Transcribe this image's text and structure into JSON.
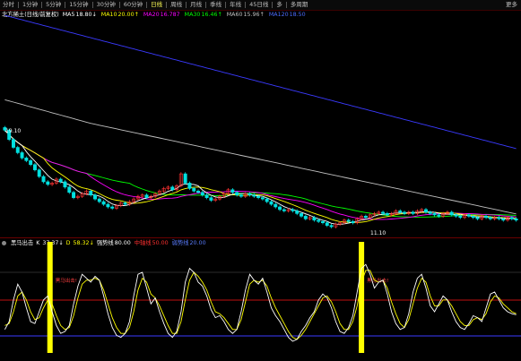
{
  "toolbar": {
    "items": [
      "分时",
      "1分钟",
      "5分钟",
      "15分钟",
      "30分钟",
      "60分钟",
      "日线",
      "周线",
      "月线",
      "季线",
      "年线",
      "45日线",
      "多",
      "多周期"
    ],
    "active_index": 6,
    "right_label": "更多"
  },
  "main_legend": {
    "title": "北方稀土(日线/前复权)",
    "ma": [
      {
        "label": "MA5",
        "value": "18.80↓",
        "color": "#ffffff"
      },
      {
        "label": "MA10",
        "value": "20.00↑",
        "color": "#ffff00"
      },
      {
        "label": "MA20",
        "value": "16.787",
        "color": "#ff00ff"
      },
      {
        "label": "MA30",
        "value": "16.46↑",
        "color": "#00ff00"
      },
      {
        "label": "MA60",
        "value": "15.96↑",
        "color": "#c0c0c0"
      },
      {
        "label": "MA120",
        "value": "18.50",
        "color": "#4a6cff"
      }
    ]
  },
  "price_labels": {
    "high": "19.10",
    "low": "11.10"
  },
  "indicator_legend": {
    "name": "黑马出击",
    "k_label": "K",
    "k_value": "37.37↓",
    "d_label": "D",
    "d_value": "58.32↓",
    "items": [
      {
        "label": "强势线",
        "value": "80.00",
        "color": "#ffffff"
      },
      {
        "label": "中轴线",
        "value": "50.00",
        "color": "#ff3030"
      },
      {
        "label": "弱势线",
        "value": "20.00",
        "color": "#5a7dff"
      }
    ]
  },
  "signal_annotations": [
    "黑马出击!"
  ],
  "colors": {
    "up": "#ff3232",
    "down": "#00e0e0",
    "ma5": "#ffffff",
    "ma10": "#ffff00",
    "ma20": "#ff00ff",
    "ma30": "#00ff00",
    "ma60": "#c0c0c0",
    "ma120": "#3a3aff",
    "signal_bar": "#ffff00"
  },
  "chart_data": {
    "type": "line",
    "candles_count": 120,
    "price_series": [
      18.9,
      18.2,
      17.6,
      17.2,
      16.8,
      16.6,
      16.3,
      15.9,
      15.4,
      15.0,
      14.8,
      14.9,
      15.2,
      15.0,
      14.6,
      14.2,
      13.8,
      13.9,
      14.1,
      14.3,
      14.0,
      13.7,
      13.5,
      13.3,
      13.1,
      13.0,
      13.2,
      13.4,
      13.3,
      13.5,
      13.7,
      13.9,
      14.0,
      13.8,
      13.9,
      14.1,
      14.3,
      14.5,
      14.6,
      14.4,
      14.7,
      15.6,
      14.9,
      14.5,
      14.3,
      14.2,
      14.0,
      13.8,
      13.6,
      13.7,
      13.9,
      14.1,
      14.4,
      14.2,
      14.0,
      13.9,
      14.1,
      14.0,
      13.9,
      13.8,
      13.7,
      13.5,
      13.3,
      13.1,
      12.9,
      12.8,
      12.9,
      12.8,
      12.6,
      12.4,
      12.2,
      12.3,
      12.1,
      12.0,
      11.9,
      11.7,
      11.6,
      11.8,
      11.9,
      12.1,
      12.0,
      11.9,
      12.2,
      12.4,
      12.3,
      12.5,
      12.6,
      12.7,
      12.6,
      12.5,
      12.6,
      12.8,
      12.7,
      12.6,
      12.7,
      12.6,
      12.8,
      12.9,
      12.7,
      12.6,
      12.5,
      12.4,
      12.6,
      12.7,
      12.5,
      12.4,
      12.3,
      12.5,
      12.4,
      12.3,
      12.2,
      12.4,
      12.3,
      12.2,
      12.3,
      12.2,
      12.1,
      12.3,
      12.2,
      12.1
    ],
    "k": [
      22,
      30,
      52,
      68,
      60,
      44,
      30,
      28,
      40,
      52,
      56,
      40,
      26,
      18,
      20,
      26,
      48,
      66,
      78,
      74,
      70,
      76,
      72,
      56,
      38,
      24,
      16,
      14,
      18,
      30,
      56,
      78,
      80,
      64,
      48,
      54,
      40,
      28,
      18,
      14,
      20,
      40,
      70,
      84,
      80,
      70,
      66,
      56,
      42,
      34,
      36,
      30,
      22,
      18,
      22,
      40,
      62,
      78,
      72,
      68,
      74,
      60,
      44,
      36,
      30,
      22,
      14,
      10,
      12,
      20,
      26,
      34,
      40,
      52,
      58,
      54,
      44,
      30,
      20,
      18,
      24,
      36,
      60,
      84,
      88,
      78,
      64,
      70,
      72,
      58,
      40,
      28,
      22,
      24,
      38,
      60,
      74,
      78,
      64,
      46,
      40,
      48,
      56,
      52,
      40,
      30,
      24,
      22,
      28,
      36,
      34,
      30,
      44,
      58,
      60,
      52,
      44,
      40,
      38,
      37
    ],
    "d": [
      26,
      28,
      40,
      56,
      60,
      52,
      40,
      32,
      34,
      44,
      52,
      48,
      36,
      26,
      22,
      24,
      36,
      54,
      68,
      72,
      72,
      74,
      72,
      62,
      48,
      34,
      24,
      18,
      18,
      24,
      40,
      62,
      74,
      70,
      58,
      54,
      46,
      36,
      26,
      18,
      18,
      30,
      52,
      72,
      80,
      76,
      70,
      62,
      50,
      40,
      38,
      34,
      28,
      22,
      22,
      32,
      50,
      68,
      72,
      70,
      72,
      66,
      54,
      44,
      36,
      28,
      20,
      14,
      12,
      16,
      22,
      30,
      38,
      46,
      54,
      56,
      50,
      40,
      28,
      22,
      22,
      30,
      46,
      70,
      82,
      82,
      72,
      70,
      72,
      64,
      50,
      38,
      28,
      24,
      32,
      48,
      64,
      74,
      70,
      56,
      46,
      46,
      52,
      52,
      46,
      38,
      30,
      26,
      26,
      32,
      34,
      32,
      38,
      50,
      56,
      54,
      48,
      44,
      40,
      38
    ],
    "signal_indices": [
      8,
      83
    ],
    "strong_line": 80,
    "middle_line": 50,
    "weak_line": 20
  }
}
